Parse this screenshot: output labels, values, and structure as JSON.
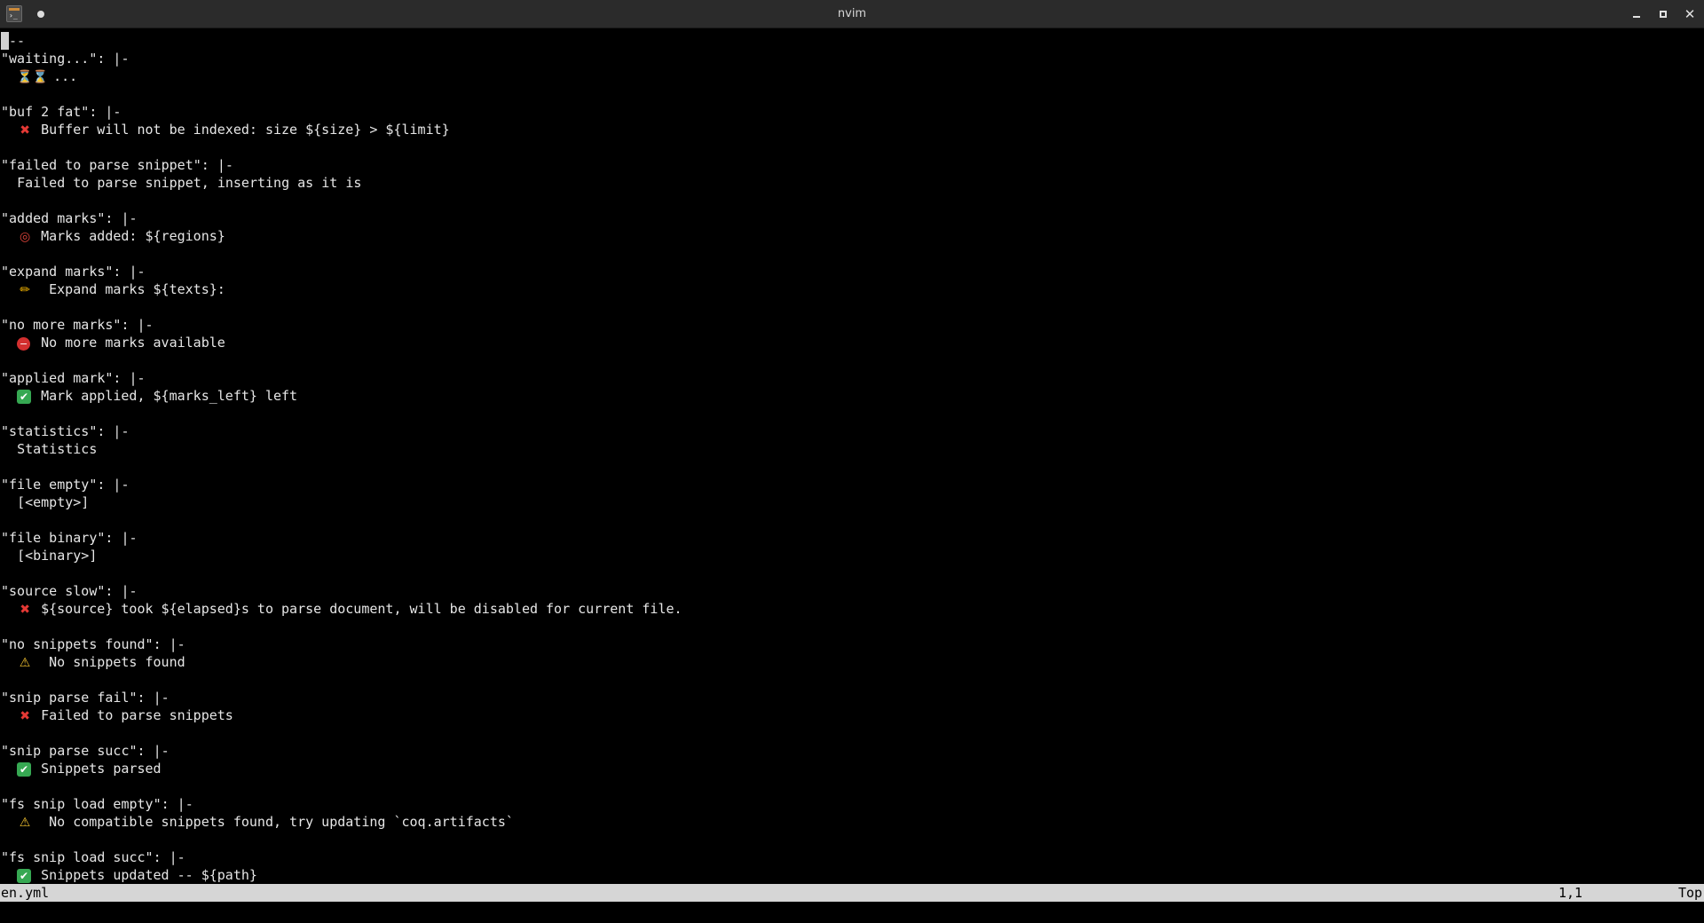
{
  "window": {
    "title": "nvim",
    "app_icon_prompt": "›_"
  },
  "colors": {
    "background": "#000000",
    "text": "#e6e6e6",
    "statusline_bg": "#d6d6d6",
    "titlebar_bg": "#2b2b2b"
  },
  "buffer": {
    "first_line_rest": "--",
    "entries": [
      {
        "key": "\"waiting...\": |-",
        "icon": "hourglass-icon",
        "glyph": "⏳⌛",
        "text": " ..."
      },
      {
        "key": "\"buf 2 fat\": |-",
        "icon": "cross-mark-icon",
        "glyph": "✖",
        "text": " Buffer will not be indexed: size ${size} > ${limit}"
      },
      {
        "key": "\"failed to parse snippet\": |-",
        "icon": "",
        "glyph": "",
        "text": "Failed to parse snippet, inserting as it is"
      },
      {
        "key": "\"added marks\": |-",
        "icon": "target-icon",
        "glyph": "◎",
        "text": " Marks added: ${regions}"
      },
      {
        "key": "\"expand marks\": |-",
        "icon": "pencil-icon",
        "glyph": "✏",
        "text": "  Expand marks ${texts}:"
      },
      {
        "key": "\"no more marks\": |-",
        "icon": "no-entry-icon",
        "glyph": "−",
        "text": " No more marks available"
      },
      {
        "key": "\"applied mark\": |-",
        "icon": "check-mark-icon",
        "glyph": "✔",
        "text": " Mark applied, ${marks_left} left"
      },
      {
        "key": "\"statistics\": |-",
        "icon": "",
        "glyph": "",
        "text": "Statistics"
      },
      {
        "key": "\"file empty\": |-",
        "icon": "",
        "glyph": "",
        "text": "[<empty>]"
      },
      {
        "key": "\"file binary\": |-",
        "icon": "",
        "glyph": "",
        "text": "[<binary>]"
      },
      {
        "key": "\"source slow\": |-",
        "icon": "cross-mark-icon",
        "glyph": "✖",
        "text": " ${source} took ${elapsed}s to parse document, will be disabled for current file."
      },
      {
        "key": "\"no snippets found\": |-",
        "icon": "warning-icon",
        "glyph": "⚠",
        "text": "  No snippets found"
      },
      {
        "key": "\"snip parse fail\": |-",
        "icon": "cross-mark-icon",
        "glyph": "✖",
        "text": " Failed to parse snippets"
      },
      {
        "key": "\"snip parse succ\": |-",
        "icon": "check-mark-icon",
        "glyph": "✔",
        "text": " Snippets parsed"
      },
      {
        "key": "\"fs snip load empty\": |-",
        "icon": "warning-icon",
        "glyph": "⚠",
        "text": "  No compatible snippets found, try updating `coq.artifacts`"
      },
      {
        "key": "\"fs snip load succ\": |-",
        "icon": "check-mark-icon",
        "glyph": "✔",
        "text": " Snippets updated -- ${path}"
      }
    ]
  },
  "statusline": {
    "file": "en.yml",
    "position": "1,1",
    "scroll": "Top"
  }
}
